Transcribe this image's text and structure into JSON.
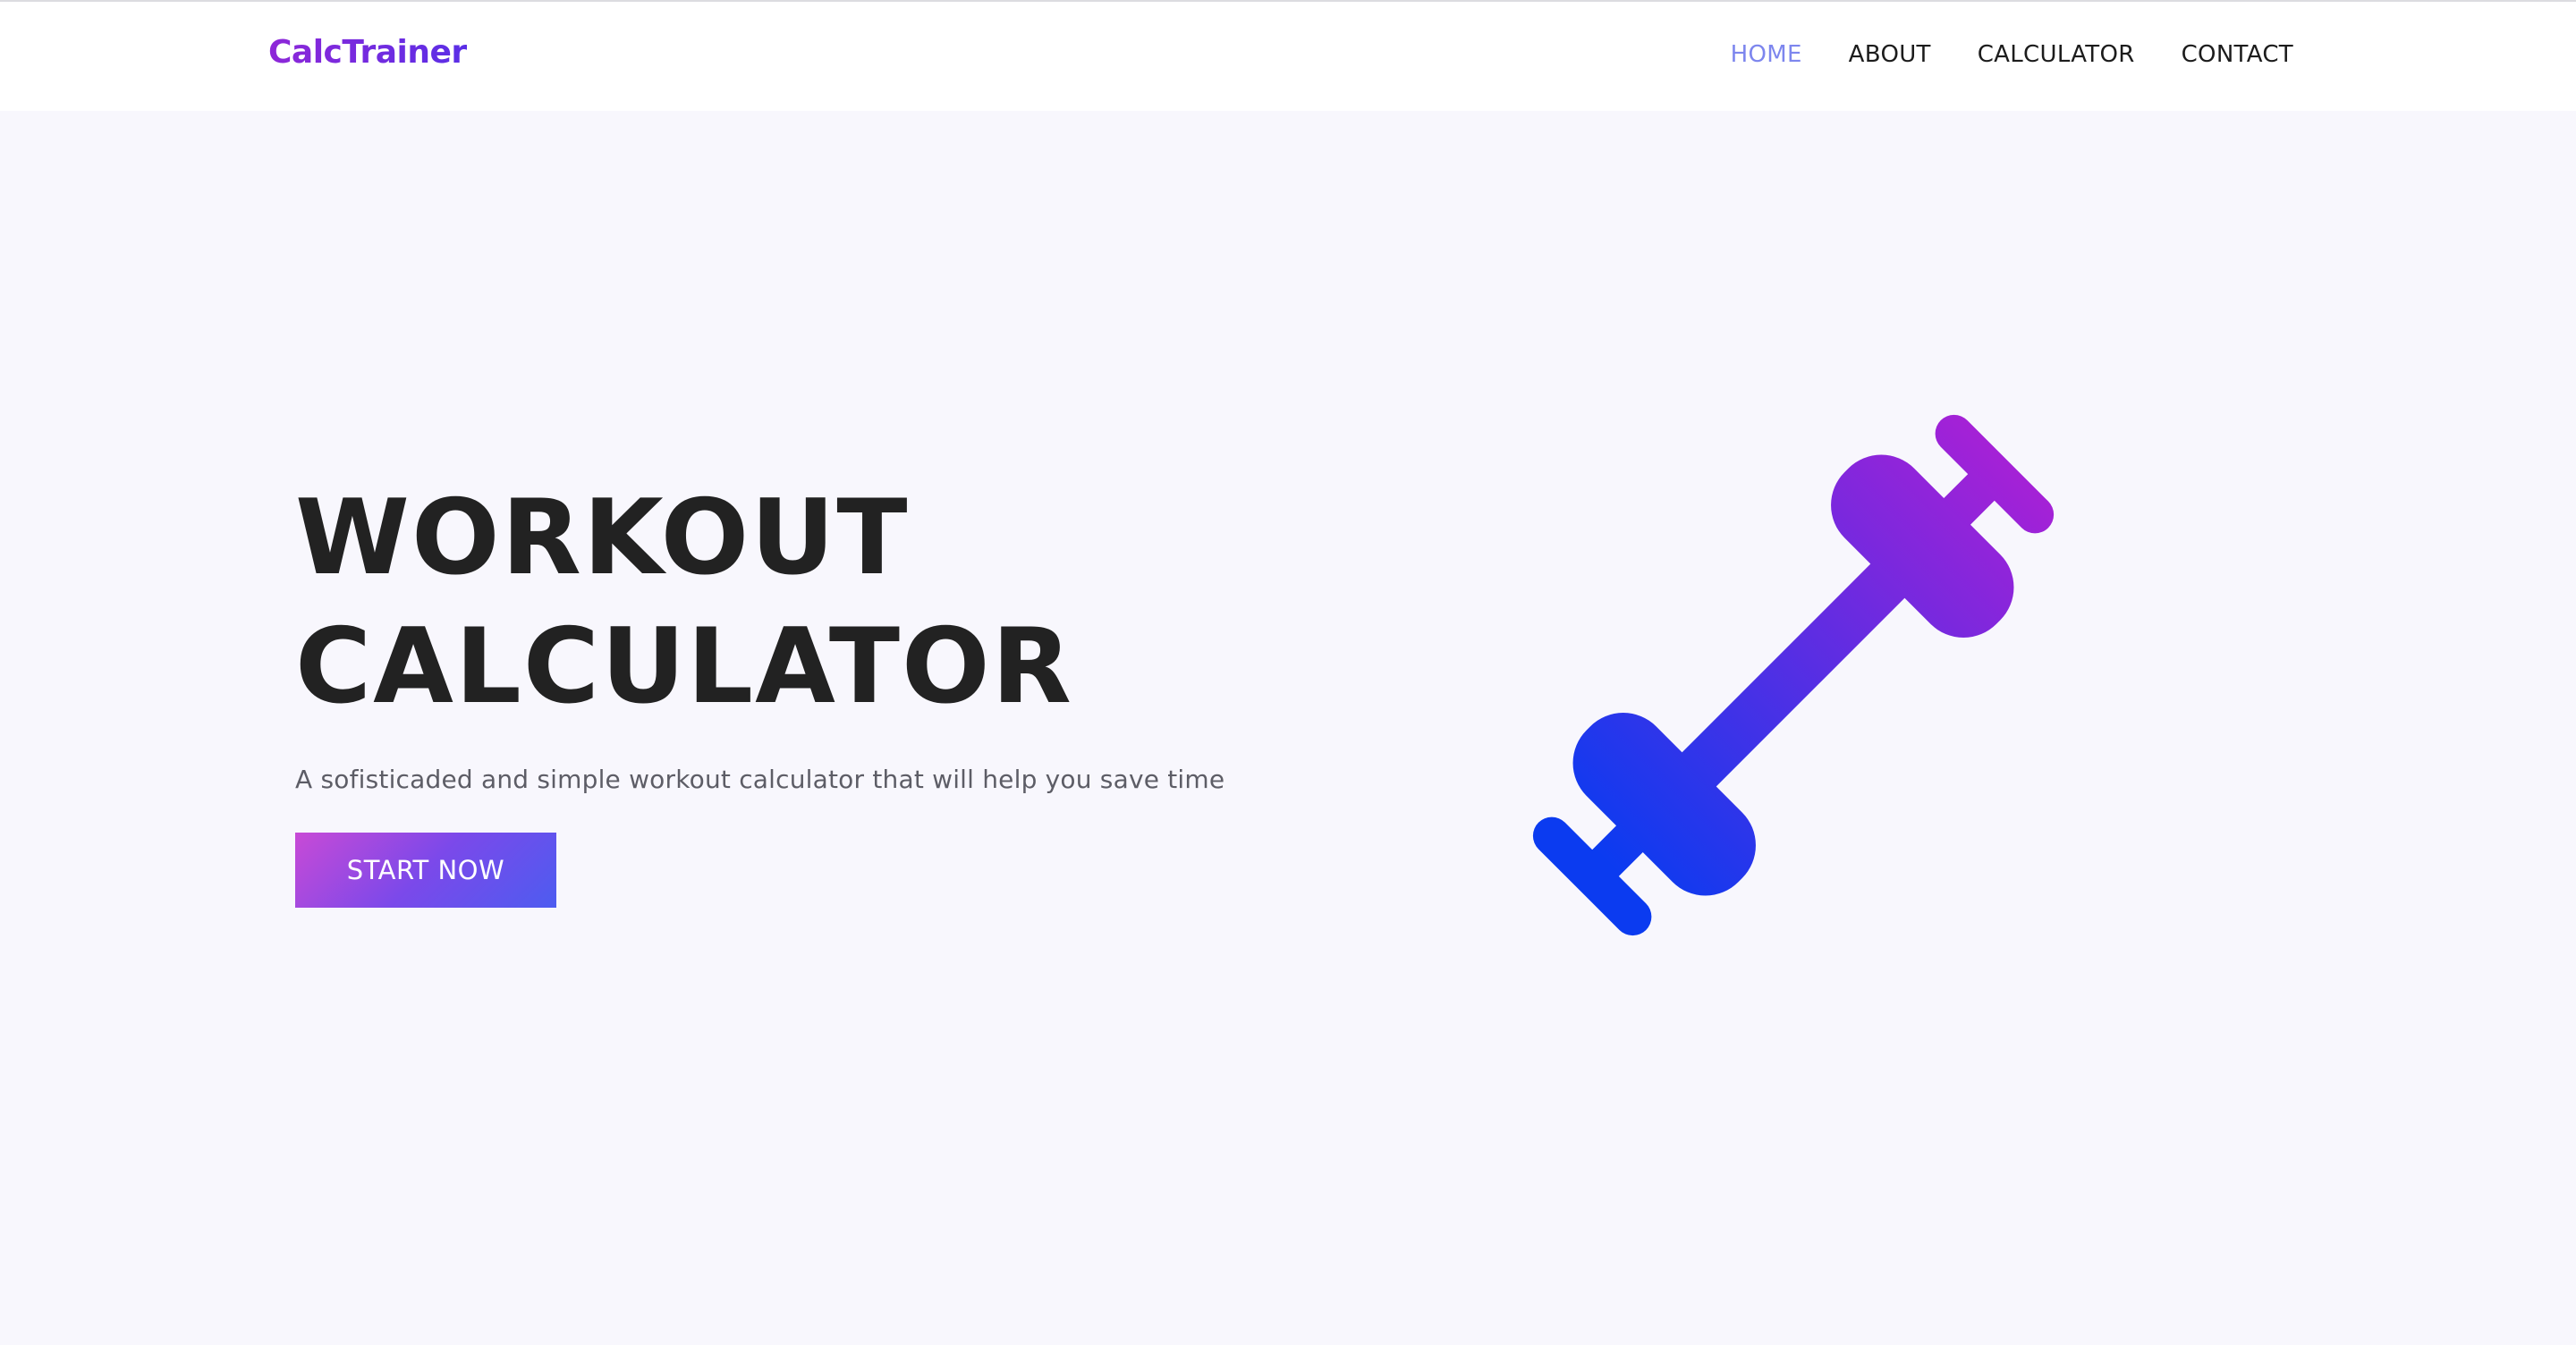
{
  "brand": {
    "name": "CalcTrainer"
  },
  "nav": {
    "items": [
      {
        "label": "HOME",
        "active": true
      },
      {
        "label": "ABOUT",
        "active": false
      },
      {
        "label": "CALCULATOR",
        "active": false
      },
      {
        "label": "CONTACT",
        "active": false
      }
    ]
  },
  "hero": {
    "title_line1": "WORKOUT",
    "title_line2": "CALCULATOR",
    "subtitle": "A sofisticaded and simple workout calculator that will help you save time",
    "cta_label": "START NOW",
    "illustration_icon": "dumbbell-icon"
  },
  "colors": {
    "brand_gradient": [
      "#8e27d8",
      "#5a2ee6"
    ],
    "nav_active": "#7d86ee",
    "cta_gradient": [
      "#c84ad6",
      "#4d5cf0"
    ],
    "icon_gradient": [
      "#a621d6",
      "#0b3bf0"
    ],
    "background": "#f8f7fd"
  }
}
